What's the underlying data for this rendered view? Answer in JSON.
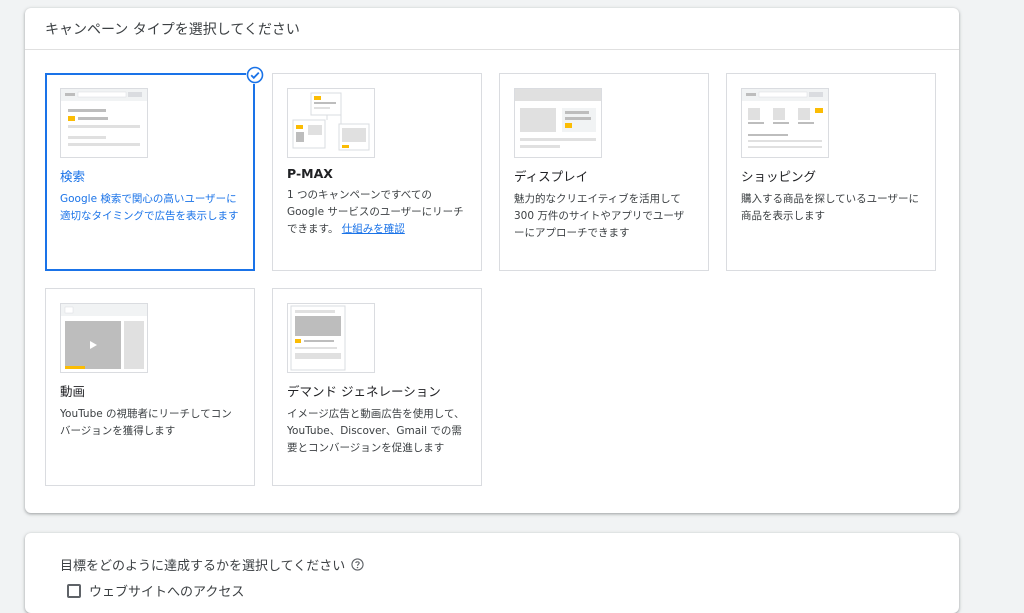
{
  "header": {
    "title": "キャンペーン タイプを選択してください"
  },
  "cards": [
    {
      "title": "検索",
      "desc": "Google 検索で関心の高いユーザーに適切なタイミングで広告を表示します"
    },
    {
      "title": "P-MAX",
      "desc": "1 つのキャンペーンですべての Google サービスのユーザーにリーチできます。",
      "link": "仕組みを確認"
    },
    {
      "title": "ディスプレイ",
      "desc": "魅力的なクリエイティブを活用して 300 万件のサイトやアプリでユーザーにアプローチできます"
    },
    {
      "title": "ショッピング",
      "desc": "購入する商品を探しているユーザーに商品を表示します"
    },
    {
      "title": "動画",
      "desc": "YouTube の視聴者にリーチしてコンバージョンを獲得します"
    },
    {
      "title": "デマンド ジェネレーション",
      "desc": "イメージ広告と動画広告を使用して、YouTube、Discover、Gmail での需要とコンバージョンを促進します"
    }
  ],
  "goal": {
    "prompt": "目標をどのように達成するかを選択してください",
    "option1": "ウェブサイトへのアクセス"
  },
  "colors": {
    "accent": "#1a73e8",
    "yellow": "#fbbc04"
  }
}
